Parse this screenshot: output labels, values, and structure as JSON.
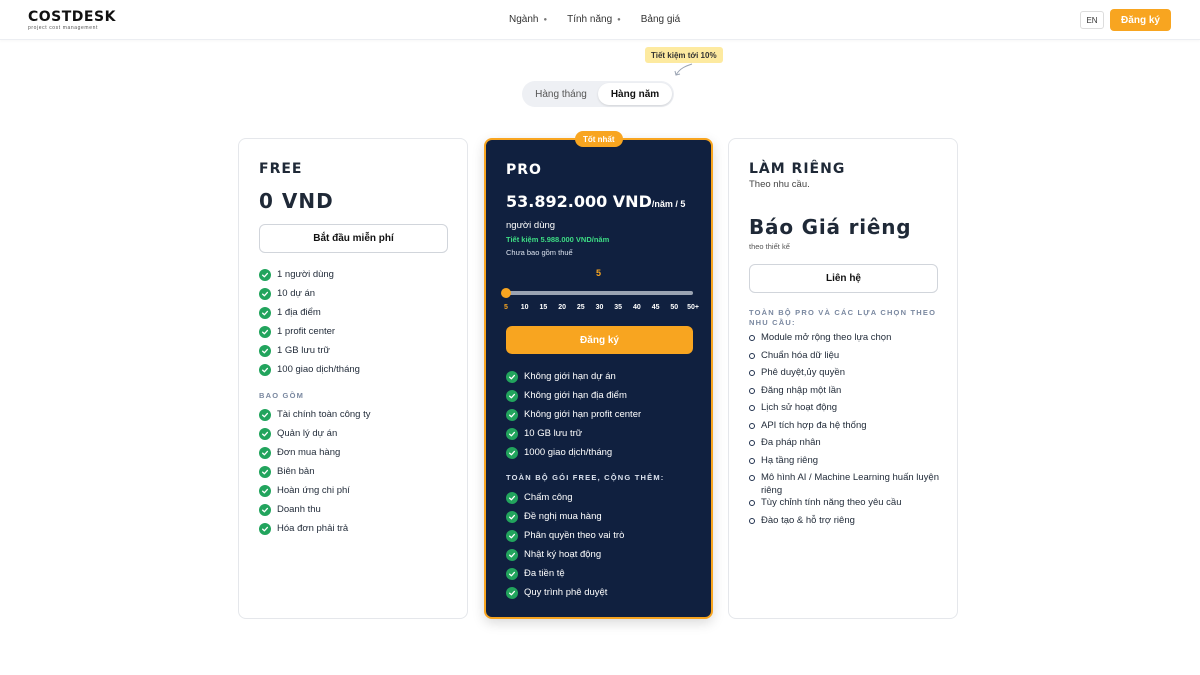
{
  "header": {
    "logo_text": "COSTDESK",
    "logo_sub": "project cost management",
    "nav": [
      {
        "label": "Ngành"
      },
      {
        "label": "Tính năng"
      },
      {
        "label": "Bảng giá"
      }
    ],
    "lang": "EN",
    "signup": "Đăng ký"
  },
  "billing": {
    "save_badge": "Tiết kiệm tới 10%",
    "monthly": "Hàng tháng",
    "yearly": "Hàng năm",
    "selected": "yearly"
  },
  "free": {
    "title": "FREE",
    "price": "0 VND",
    "cta": "Bắt đầu miễn phí",
    "features": [
      "1 người dùng",
      "10 dự án",
      "1 địa điểm",
      "1 profit center",
      "1 GB lưu trữ",
      "100 giao dịch/tháng"
    ],
    "includes_label": "BAO GỒM",
    "includes": [
      "Tài chính toàn công ty",
      "Quản lý dự án",
      "Đơn mua hàng",
      "Biên bản",
      "Hoàn ứng chi phí",
      "Doanh thu",
      "Hóa đơn phải trả"
    ]
  },
  "pro": {
    "badge": "Tốt nhất",
    "title": "PRO",
    "price": "53.892.000 VND",
    "price_suffix": "/năm / 5",
    "price_line2": "người dùng",
    "savings": "Tiết kiệm 5.988.000 VND/năm",
    "tax_note": "Chưa bao gồm thuế",
    "slider": {
      "value": 5,
      "value_label": "5",
      "ticks": [
        "5",
        "10",
        "15",
        "20",
        "25",
        "30",
        "35",
        "40",
        "45",
        "50",
        "50+"
      ]
    },
    "cta": "Đăng ký",
    "features": [
      "Không giới hạn dự án",
      "Không giới hạn địa điểm",
      "Không giới hạn profit center",
      "10 GB lưu trữ",
      "1000 giao dịch/tháng"
    ],
    "plus_label": "TOÀN BỘ GÓI FREE, CỘNG THÊM:",
    "plus": [
      "Chấm công",
      "Đề nghị mua hàng",
      "Phân quyền theo vai trò",
      "Nhật ký hoạt động",
      "Đa tiền tệ",
      "Quy trình phê duyệt"
    ]
  },
  "custom": {
    "title": "LÀM RIÊNG",
    "subtitle": "Theo nhu cầu.",
    "price": "Báo Giá riêng",
    "price_note": "theo thiết kế",
    "cta": "Liên hệ",
    "includes_label": "TOÀN BỘ PRO VÀ CÁC LỰA CHỌN THEO NHU CẦU:",
    "includes": [
      "Module mở rộng theo lựa chọn",
      "Chuẩn hóa dữ liệu",
      "Phê duyệt,ủy quyền",
      "Đăng nhập một lần",
      "Lịch sử hoạt động",
      "API tích hợp đa hệ thống",
      "Đa pháp nhân",
      "Hạ tầng riêng",
      "Mô hình AI / Machine Learning huấn luyện riêng",
      "Tùy chỉnh tính năng theo yêu cầu",
      "Đào tạo & hỗ trợ riêng"
    ]
  },
  "colors": {
    "accent": "#f8a520",
    "pro_bg": "#10203f",
    "check": "#22a45d",
    "savings": "#3ddc84"
  }
}
